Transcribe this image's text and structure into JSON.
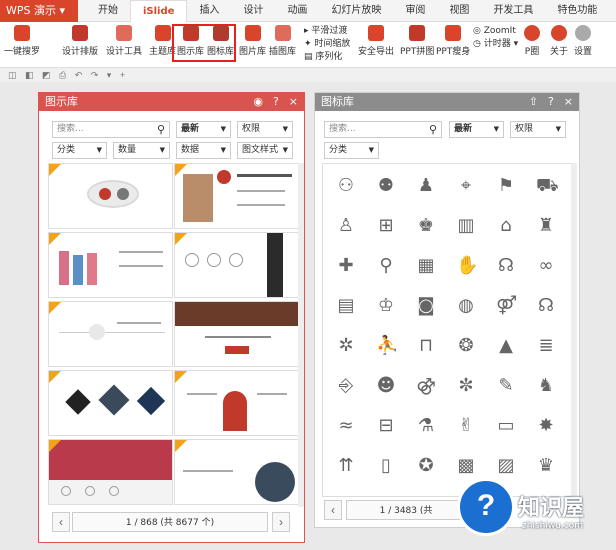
{
  "app": {
    "name": "WPS 演示"
  },
  "tabs": [
    "开始",
    "iSlide",
    "插入",
    "设计",
    "动画",
    "幻灯片放映",
    "审阅",
    "视图",
    "开发工具",
    "特色功能"
  ],
  "active_tab": "iSlide",
  "ribbon": {
    "buttons": [
      "一键搜罗",
      "设计排版",
      "设计工具",
      "主题库",
      "图示库",
      "图标库",
      "图片库",
      "插图库",
      "安全导出",
      "PPT拼图",
      "PPT瘦身",
      "P圈",
      "关于",
      "设置"
    ],
    "small_items": [
      "平滑过渡",
      "时间缩放",
      "序列化"
    ],
    "small_items2": [
      "ZoomIt",
      "计时器"
    ]
  },
  "left_panel": {
    "title": "图示库",
    "accent": "#d9534f",
    "search_placeholder": "搜索...",
    "filter1": "最新",
    "filter2": "权限",
    "filter3": "分类",
    "filter4": "数量",
    "filter5": "数据",
    "filter6": "图文样式",
    "pager": "1 / 868 (共 8677 个)"
  },
  "right_panel": {
    "title": "图标库",
    "accent": "#8c8c8c",
    "search_placeholder": "搜索...",
    "filter1": "最新",
    "filter2": "权限",
    "filter3": "分类",
    "pager": "1 / 3483 (共"
  },
  "icons": [
    "people-meeting-icon",
    "team-icon",
    "person-icon",
    "location-icon",
    "flag-icon",
    "ambulance-icon",
    "doctor-icon",
    "org-chart-icon",
    "group-icon",
    "elevator-icon",
    "shop-icon",
    "toilet-icon",
    "medic-icon",
    "bicycle-icon",
    "bricks-icon",
    "clap-icon",
    "support-icon",
    "glasses-icon",
    "document-icon",
    "presenter-icon",
    "camera-icon",
    "globe-icon",
    "couple-icon",
    "headphones-icon",
    "settings-icon",
    "meeting-icon",
    "desk-icon",
    "idea-icon",
    "podium-icon",
    "database-icon",
    "exit-icon",
    "group-chat-icon",
    "family-icon",
    "fan-icon",
    "chart-down-icon",
    "dog-icon",
    "swimmer-icon",
    "bus-icon",
    "chemist-icon",
    "handshake-icon",
    "air-conditioner-icon",
    "bomb-icon",
    "arrows-up-icon",
    "file-icon",
    "medal-icon",
    "qr-code-icon",
    "stats-icon",
    "crowd-icon"
  ],
  "watermark": {
    "title": "知识屋",
    "subtitle": "zhishiwu.com"
  }
}
